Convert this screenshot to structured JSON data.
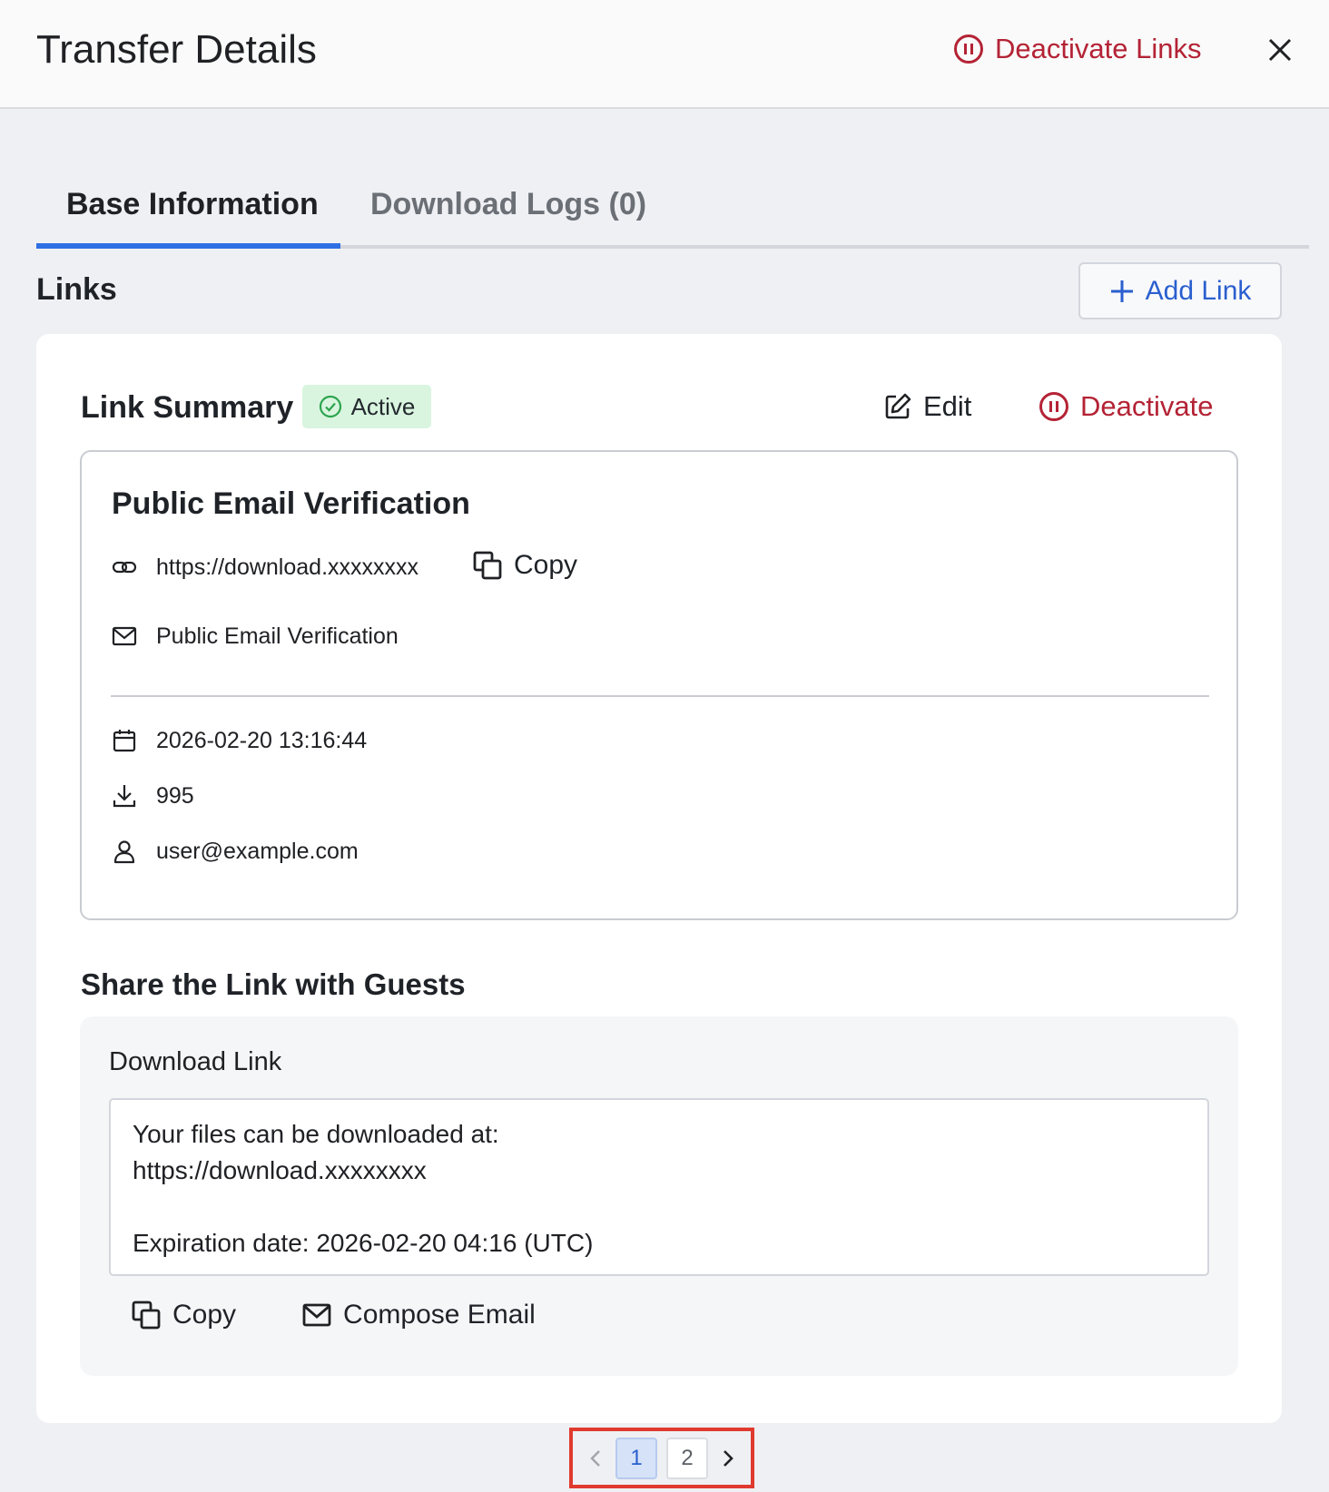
{
  "header": {
    "title": "Transfer Details",
    "deactivate_links_label": "Deactivate Links",
    "accent_color": "#b42335"
  },
  "tabs": [
    {
      "label": "Base Information",
      "active": true
    },
    {
      "label": "Download Logs (0)",
      "active": false
    }
  ],
  "links_section": {
    "title": "Links",
    "add_link_label": "Add Link"
  },
  "link_summary": {
    "title": "Link Summary",
    "status": "Active",
    "edit_label": "Edit",
    "deactivate_label": "Deactivate",
    "name": "Public Email Verification",
    "url": "https://download.xxxxxxxx",
    "copy_label": "Copy",
    "verification": "Public Email Verification",
    "date": "2026-02-20 13:16:44",
    "downloads": "995",
    "owner": "user@example.com"
  },
  "share": {
    "title": "Share the Link with Guests",
    "download_link_label": "Download Link",
    "message": "Your files can be downloaded at:\nhttps://download.xxxxxxxx\n\nExpiration date: 2026-02-20 04:16 (UTC)",
    "copy_label": "Copy",
    "compose_label": "Compose Email"
  },
  "pagination": {
    "pages": [
      "1",
      "2"
    ],
    "current": "1"
  }
}
